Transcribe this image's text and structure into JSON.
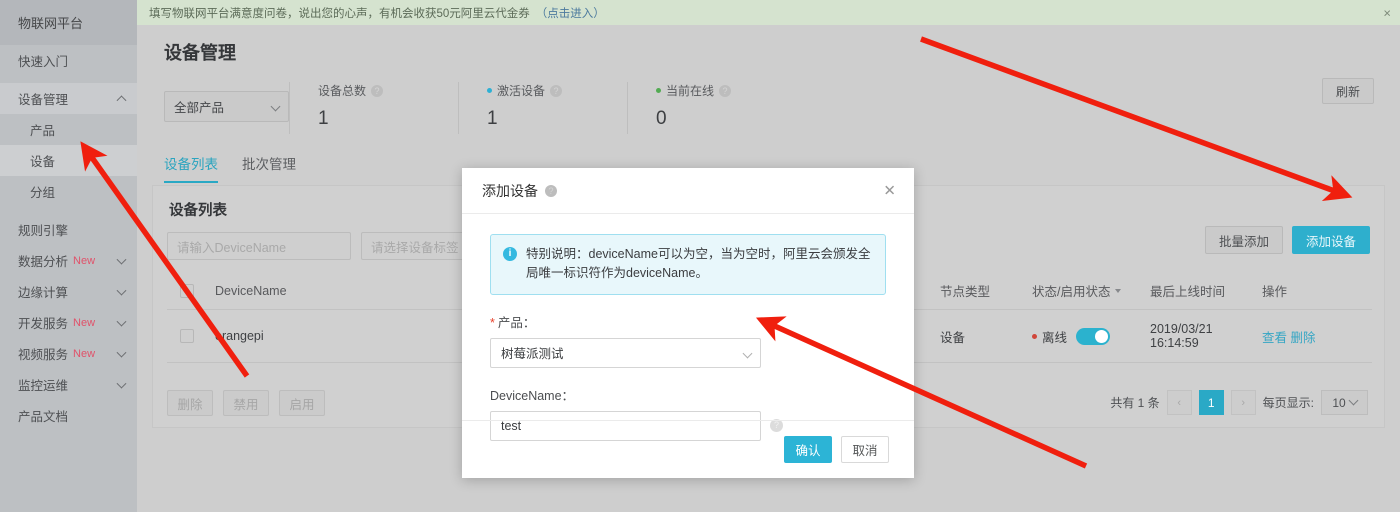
{
  "banner": {
    "text": "填写物联网平台满意度问卷，说出您的心声，有机会收获50元阿里云代金券",
    "link": "（点击进入）",
    "close": "×"
  },
  "sidebar": {
    "brand": "物联网平台",
    "items": [
      {
        "label": "快速入门",
        "badge": "",
        "chevron": "none",
        "level": "top",
        "state": ""
      },
      {
        "label": "设备管理",
        "badge": "",
        "chevron": "up",
        "level": "top",
        "state": "active"
      },
      {
        "label": "产品",
        "badge": "",
        "chevron": "none",
        "level": "sub",
        "state": ""
      },
      {
        "label": "设备",
        "badge": "",
        "chevron": "none",
        "level": "sub",
        "state": "selected"
      },
      {
        "label": "分组",
        "badge": "",
        "chevron": "none",
        "level": "sub",
        "state": ""
      },
      {
        "label": "规则引擎",
        "badge": "",
        "chevron": "none",
        "level": "top",
        "state": ""
      },
      {
        "label": "数据分析",
        "badge": "New",
        "chevron": "down",
        "level": "top",
        "state": ""
      },
      {
        "label": "边缘计算",
        "badge": "",
        "chevron": "down",
        "level": "top",
        "state": ""
      },
      {
        "label": "开发服务",
        "badge": "New",
        "chevron": "down",
        "level": "top",
        "state": ""
      },
      {
        "label": "视频服务",
        "badge": "New",
        "chevron": "down",
        "level": "top",
        "state": ""
      },
      {
        "label": "监控运维",
        "badge": "",
        "chevron": "down",
        "level": "top",
        "state": ""
      },
      {
        "label": "产品文档",
        "badge": "",
        "chevron": "none",
        "level": "top",
        "state": ""
      }
    ]
  },
  "page": {
    "title": "设备管理",
    "refresh_label": "刷新",
    "product_filter": "全部产品"
  },
  "stats": [
    {
      "label": "设备总数",
      "value": "1",
      "dot": "",
      "help": "?"
    },
    {
      "label": "激活设备",
      "value": "1",
      "dot": "#2eb0d4",
      "help": "?"
    },
    {
      "label": "当前在线",
      "value": "0",
      "dot": "#52ab52",
      "help": "?"
    }
  ],
  "tabs": [
    {
      "label": "设备列表",
      "active": true
    },
    {
      "label": "批次管理",
      "active": false
    }
  ],
  "card": {
    "title": "设备列表",
    "batch_add_label": "批量添加",
    "add_device_label": "添加设备",
    "filters": [
      {
        "placeholder": "请输入DeviceName",
        "type": "text"
      },
      {
        "placeholder": "请选择设备标签",
        "type": "select"
      }
    ],
    "columns": {
      "devicename": "DeviceName",
      "node_type": "节点类型",
      "status": "状态/启用状态",
      "last_online": "最后上线时间",
      "operation": "操作"
    },
    "rows": [
      {
        "devicename": "orangepi",
        "node_type": "设备",
        "status_text": "离线",
        "status_dot": "#d0463a",
        "toggle_on": true,
        "last_online_date": "2019/03/21",
        "last_online_time": "16:14:59",
        "op_view": "查看",
        "op_delete": "删除"
      }
    ],
    "bulk_buttons": [
      "删除",
      "禁用",
      "启用"
    ],
    "pager": {
      "total": "共有 1 条",
      "prev": "‹",
      "current": "1",
      "next": "›",
      "page_size_label": "每页显示:",
      "page_size": "10"
    }
  },
  "modal": {
    "title": "添加设备",
    "help": "?",
    "close": "✕",
    "alert_icon": "i",
    "alert_text": "特别说明：deviceName可以为空，当为空时，阿里云会颁发全局唯一标识符作为deviceName。",
    "product_label": "产品：",
    "product_required": "*",
    "product_value": "树莓派测试",
    "devicename_label": "DeviceName：",
    "devicename_value": "test",
    "devicename_help": "?",
    "confirm_label": "确认",
    "cancel_label": "取消"
  },
  "annotations": {
    "color": "#f01f0e",
    "count": 3
  }
}
